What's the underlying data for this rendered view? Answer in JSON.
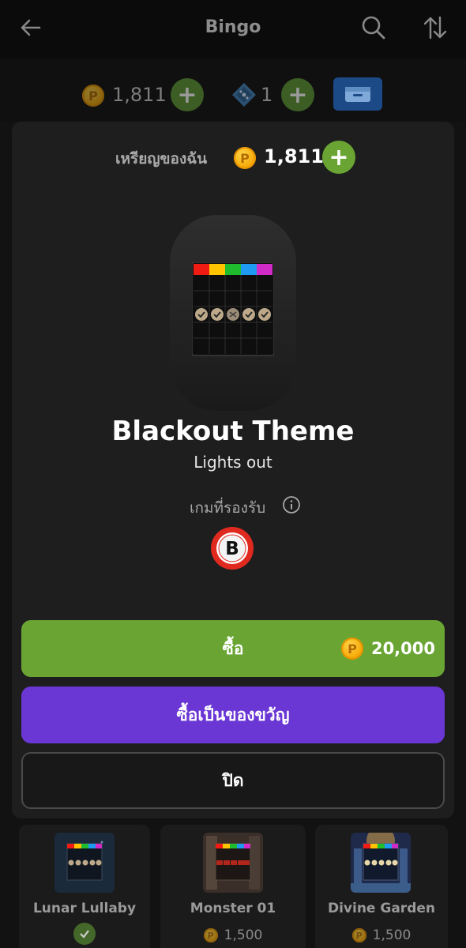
{
  "header": {
    "title": "Bingo",
    "back_icon": "arrow-left-icon",
    "search_icon": "search-icon",
    "sort_icon": "sort-icon"
  },
  "currency_bar": {
    "coins": "1,811",
    "gems": "1"
  },
  "modal": {
    "balance_label": "เหรียญของฉัน",
    "balance_value": "1,811",
    "item_name": "Blackout Theme",
    "item_subtitle": "Lights out",
    "supported_games_label": "เกมที่รองรับ",
    "supported_game_letter": "B",
    "buy_label": "ซื้อ",
    "buy_price": "20,000",
    "gift_label": "ซื้อเป็นของขวัญ",
    "close_label": "ปิด"
  },
  "themes": [
    {
      "name": "Lunar Lullaby",
      "owned": true,
      "price": ""
    },
    {
      "name": "Monster 01",
      "owned": false,
      "price": "1,500"
    },
    {
      "name": "Divine Garden",
      "owned": false,
      "price": "1,500"
    }
  ],
  "colors": {
    "accent_green": "#6aa534",
    "gift_purple": "#6a37d4",
    "coin_gold": "#f5a400",
    "wallet_blue": "#1c4a86",
    "bingo_red": "#e0291f"
  }
}
